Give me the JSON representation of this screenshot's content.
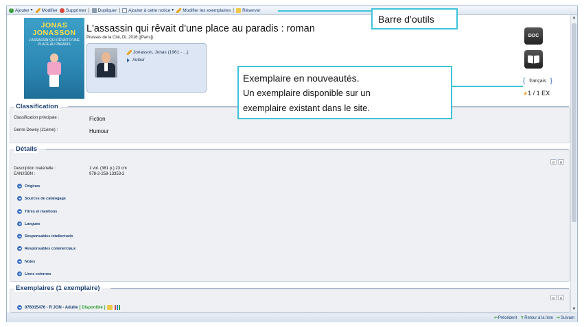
{
  "toolbar": {
    "add": "Ajouter",
    "edit": "Modifier",
    "delete": "Supprimer",
    "duplicate": "Dupliquer",
    "add_to_record": "Ajouter à cette notice",
    "edit_copies": "Modifier les exemplaires",
    "reserve": "Réserver"
  },
  "cover": {
    "author": "JONAS JONASSON",
    "title": "L'assassin qui rêvait d'une place au paradis"
  },
  "record": {
    "title": "L'assassin qui rêvait d'une place au paradis : roman",
    "publisher": "Presses de la Cité, DL 2016 ([Paris])"
  },
  "author": {
    "name": "Jonasson, Jonas (1961 - ...)",
    "role": "Auteur"
  },
  "side": {
    "doc_label": "DOC",
    "language": "français",
    "copies": "1 / 1 EX"
  },
  "classification": {
    "title": "Classification",
    "fields": [
      {
        "label": "Classification principale :",
        "value": "Fiction"
      },
      {
        "label": "Genre Dewey (21ème) :",
        "value": "Humour"
      }
    ]
  },
  "details": {
    "title": "Détails",
    "fields": [
      {
        "label": "Description matérielle :",
        "value": "1 vol. (381 p.) 23 cm"
      },
      {
        "label": "EAN/ISBN :",
        "value": "978-2-258-13353-2"
      }
    ],
    "sections": [
      "Origines",
      "Sources de catalogage",
      "Titres et mentions",
      "Langues",
      "Responsables intellectuels",
      "Responsables commerciaux",
      "Notes",
      "Liens externes"
    ]
  },
  "copies_section": {
    "title": "Exemplaires (1 exemplaire)",
    "item_label": "076015476 - R JON - Adulte",
    "status": "[ Disponible ]"
  },
  "footer": {
    "previous": "Précédent",
    "back": "Retour à la liste",
    "next": "Suivant"
  },
  "callouts": {
    "toolbar": "Barre d’outils",
    "copy_line1": "Exemplaire en nouveautés.",
    "copy_line2": "Un exemplaire disponible sur un",
    "copy_line3": "exemplaire existant dans le site."
  },
  "colors": {
    "accent": "#1a3e72",
    "callout_border": "#3ec3dc",
    "available": "#2a9a2a"
  }
}
